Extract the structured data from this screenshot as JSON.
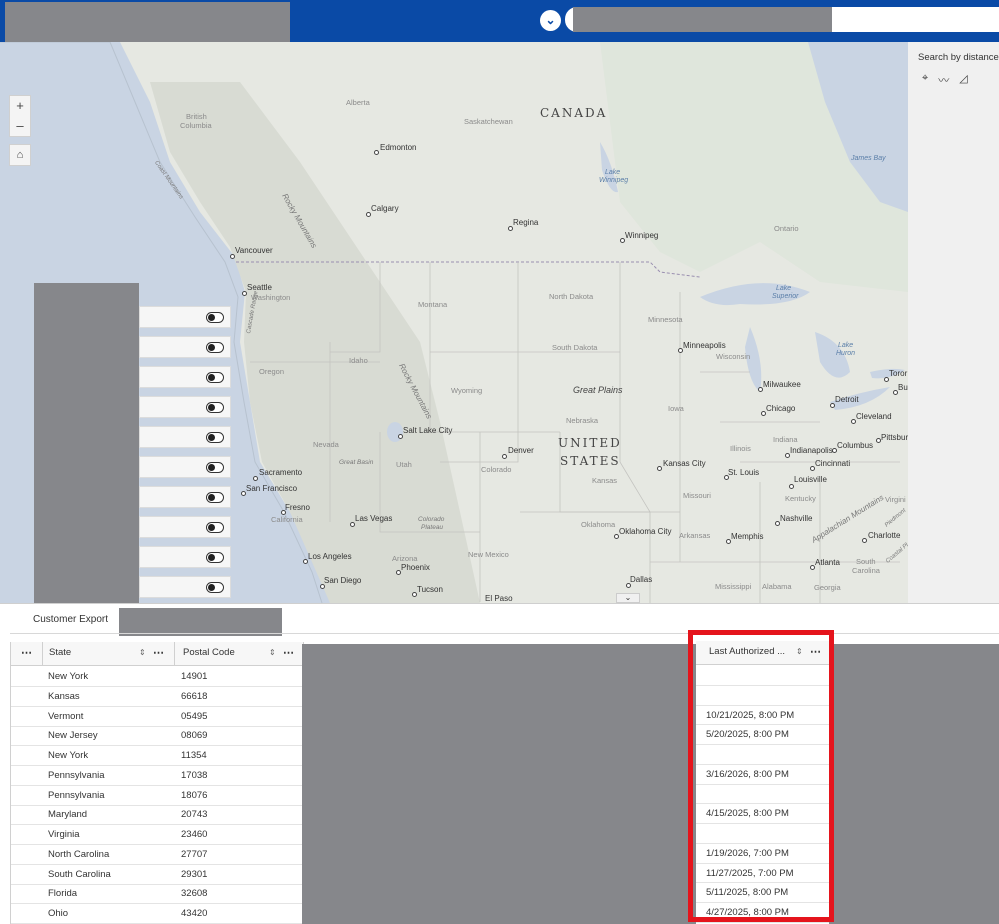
{
  "map": {
    "controls": {
      "zoom_in": "+",
      "zoom_out": "–",
      "home": "⌂"
    },
    "labels": {
      "canada": "CANADA",
      "united": "UNITED",
      "states": "STATES",
      "british_columbia_1": "British",
      "british_columbia_2": "Columbia",
      "alberta": "Alberta",
      "saskatchewan": "Saskatchewan",
      "ontario": "Ontario",
      "montana": "Montana",
      "north_dakota": "North Dakota",
      "south_dakota": "South Dakota",
      "minnesota": "Minnesota",
      "wisconsin": "Wisconsin",
      "idaho": "Idaho",
      "oregon": "Oregon",
      "wyoming": "Wyoming",
      "nebraska": "Nebraska",
      "iowa": "Iowa",
      "illinois": "Illinois",
      "indiana": "Indiana",
      "nevada": "Nevada",
      "utah": "Utah",
      "colorado": "Colorado",
      "kansas": "Kansas",
      "missouri": "Missouri",
      "kentucky": "Kentucky",
      "california": "California",
      "arizona": "Arizona",
      "new_mexico": "New Mexico",
      "oklahoma": "Oklahoma",
      "arkansas": "Arkansas",
      "mississippi": "Mississippi",
      "alabama": "Alabama",
      "georgia": "Georgia",
      "south_carolina_1": "South",
      "south_carolina_2": "Carolina",
      "virginia": "Virgini",
      "washington": "Washington",
      "great_plains": "Great Plains",
      "great_basin": "Great Basin",
      "colorado_plateau_1": "Colorado",
      "colorado_plateau_2": "Plateau",
      "rocky_1": "Rocky Mountains",
      "rocky_2": "Rocky Mountains",
      "coast_mountains": "Coast Mountains",
      "cascade_range": "Cascade Range",
      "appalachian": "Appalachian Mountains",
      "piedmont": "Piedmont",
      "coastal_plain": "Coastal Pl",
      "james_bay": "James Bay",
      "lake_winnipeg_1": "Lake",
      "lake_winnipeg_2": "Winnipeg",
      "lake_superior_1": "Lake",
      "lake_superior_2": "Superior",
      "lake_huron_1": "Lake",
      "lake_huron_2": "Huron"
    },
    "cities": {
      "edmonton": "Edmonton",
      "calgary": "Calgary",
      "regina": "Regina",
      "winnipeg": "Winnipeg",
      "vancouver": "Vancouver",
      "seattle": "Seattle",
      "minneapolis": "Minneapolis",
      "milwaukee": "Milwaukee",
      "toronto": "Toror",
      "buffalo": "Bu",
      "detroit": "Detroit",
      "chicago": "Chicago",
      "cleveland": "Cleveland",
      "pittsburgh": "Pittsbur",
      "indianapolis": "Indianapolis",
      "columbus": "Columbus",
      "cincinnati": "Cincinnati",
      "salt_lake_city": "Salt Lake City",
      "denver": "Denver",
      "kansas_city": "Kansas City",
      "st_louis": "St. Louis",
      "louisville": "Louisville",
      "sacramento": "Sacramento",
      "san_francisco": "San Francisco",
      "fresno": "Fresno",
      "las_vegas": "Las Vegas",
      "nashville": "Nashville",
      "charlotte": "Charlotte",
      "oklahoma_city": "Oklahoma City",
      "memphis": "Memphis",
      "los_angeles": "Los Angeles",
      "phoenix": "Phoenix",
      "san_diego": "San Diego",
      "tucson": "Tucson",
      "atlanta": "Atlanta",
      "dallas": "Dallas",
      "el_paso": "El Paso"
    }
  },
  "right_panel": {
    "title": "Search by distance",
    "tools": [
      "point-tool-icon",
      "line-tool-icon",
      "polygon-tool-icon"
    ]
  },
  "tabs": {
    "active": "Customer Export"
  },
  "table": {
    "columns": {
      "state": "State",
      "postal": "Postal Code",
      "last_authorized": "Last Authorized ..."
    },
    "rows": [
      {
        "state": "New York",
        "postal": "14901",
        "last": ""
      },
      {
        "state": "Kansas",
        "postal": "66618",
        "last": ""
      },
      {
        "state": "Vermont",
        "postal": "05495",
        "last": "10/21/2025, 8:00 PM"
      },
      {
        "state": "New Jersey",
        "postal": "08069",
        "last": "5/20/2025, 8:00 PM"
      },
      {
        "state": "New York",
        "postal": "11354",
        "last": ""
      },
      {
        "state": "Pennsylvania",
        "postal": "17038",
        "last": "3/16/2026, 8:00 PM"
      },
      {
        "state": "Pennsylvania",
        "postal": "18076",
        "last": ""
      },
      {
        "state": "Maryland",
        "postal": "20743",
        "last": "4/15/2025, 8:00 PM"
      },
      {
        "state": "Virginia",
        "postal": "23460",
        "last": ""
      },
      {
        "state": "North Carolina",
        "postal": "27707",
        "last": "1/19/2026, 7:00 PM"
      },
      {
        "state": "South Carolina",
        "postal": "29301",
        "last": "11/27/2025, 7:00 PM"
      },
      {
        "state": "Florida",
        "postal": "32608",
        "last": "5/11/2025, 8:00 PM"
      },
      {
        "state": "Ohio",
        "postal": "43420",
        "last": "4/27/2025, 8:00 PM"
      }
    ]
  },
  "colors": {
    "header": "#0a4aa6",
    "redaction": "#86878b",
    "highlight": "#e5141c"
  }
}
